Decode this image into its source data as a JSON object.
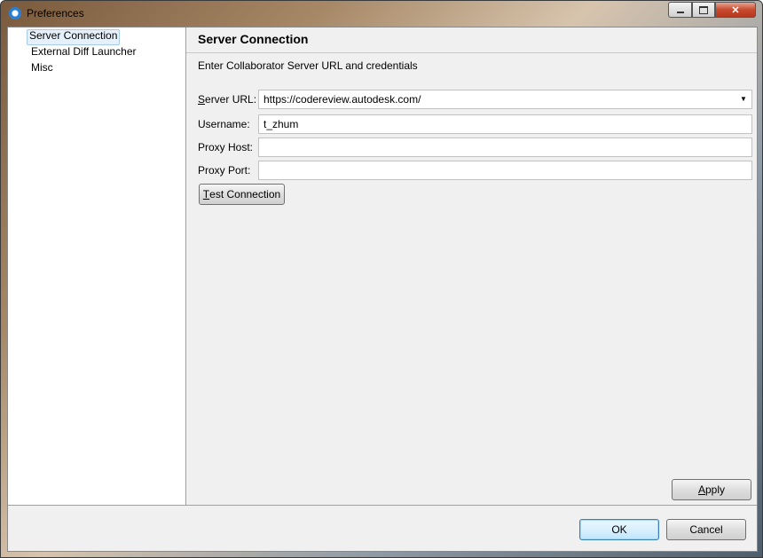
{
  "window": {
    "title": "Preferences",
    "controls": {
      "minimize": "minimize",
      "maximize": "maximize",
      "close": "✕"
    }
  },
  "tree": {
    "items": [
      {
        "label": "Server Connection",
        "selected": true
      },
      {
        "label": "External Diff Launcher",
        "selected": false
      },
      {
        "label": "Misc",
        "selected": false
      }
    ]
  },
  "panel": {
    "title": "Server Connection",
    "description": "Enter Collaborator Server URL and credentials",
    "server_url": {
      "label_first": "S",
      "label_rest": "erver URL:",
      "value": "https://codereview.autodesk.com/"
    },
    "username": {
      "label": "Username:",
      "value": "t_zhum"
    },
    "proxy_host": {
      "label": "Proxy Host:",
      "value": ""
    },
    "proxy_port": {
      "label": "Proxy Port:",
      "value": ""
    },
    "test_button": {
      "label_first": "T",
      "label_rest": "est Connection"
    },
    "apply_button": {
      "label_first": "A",
      "label_rest": "pply"
    }
  },
  "footer": {
    "ok_label": "OK",
    "cancel_label": "Cancel"
  }
}
